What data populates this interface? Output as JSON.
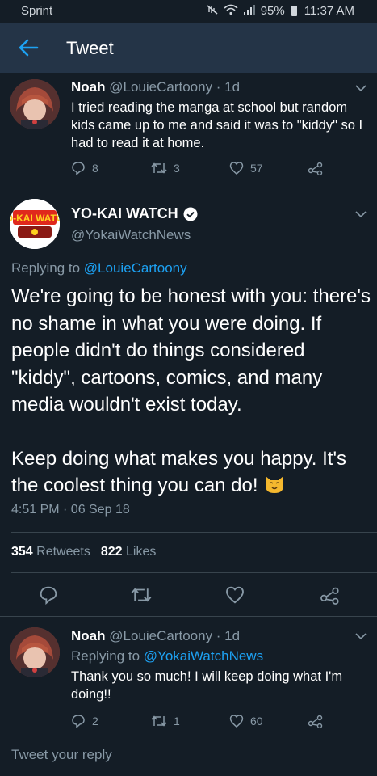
{
  "status_bar": {
    "carrier": "Sprint",
    "battery": "95%",
    "time": "11:37 AM"
  },
  "header": {
    "title": "Tweet"
  },
  "parent_tweet": {
    "name": "Noah",
    "handle": "@LouieCartoony · 1d",
    "text": "I tried reading the manga at school but random kids came up to me and said it was to \"kiddy\" so I had to read it at home.",
    "replies": "8",
    "retweets": "3",
    "likes": "57"
  },
  "main_tweet": {
    "name": "YO-KAI WATCH",
    "handle": "@YokaiWatchNews",
    "replying_prefix": "Replying to",
    "replying_to": "@LouieCartoony",
    "paragraph1": "We're going to be honest with you: there's no shame in what you were doing. If people didn't do things considered \"kiddy\", cartoons, comics, and many media wouldn't exist today.",
    "paragraph2": "Keep doing what makes you happy. It's the coolest thing you can do!",
    "timestamp": "4:51 PM · 06 Sep 18",
    "retweet_count": "354",
    "retweet_label": "Retweets",
    "like_count": "822",
    "like_label": "Likes",
    "avatar_logo_text": "YO-KAI WATCH"
  },
  "reply_tweet": {
    "name": "Noah",
    "handle": "@LouieCartoony · 1d",
    "replying_prefix": "Replying to",
    "replying_to": "@YokaiWatchNews",
    "text": "Thank you so much! I will keep doing what I'm doing!!",
    "replies": "2",
    "retweets": "1",
    "likes": "60"
  },
  "reply_box": {
    "placeholder": "Tweet your reply"
  },
  "colors": {
    "background": "#141d26",
    "header": "#243447",
    "muted": "#8899a6",
    "link": "#1da1f2",
    "divider": "#38444d"
  }
}
